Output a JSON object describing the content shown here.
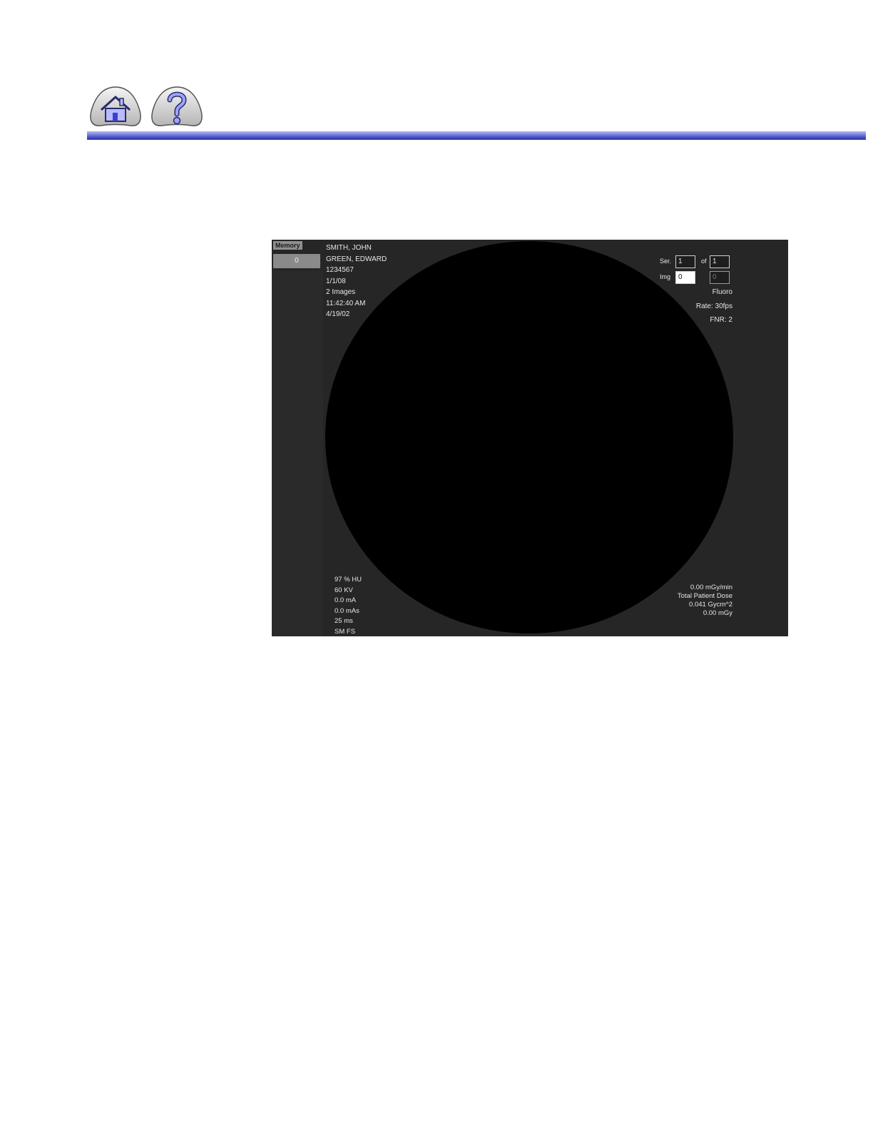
{
  "nav": {
    "home_icon": "home-icon",
    "help_icon": "question-mark-icon",
    "accent": "#4a52c8"
  },
  "memory": {
    "label": "Memory",
    "value": "0"
  },
  "patient": {
    "lines": [
      "SMITH, JOHN",
      "GREEN, EDWARD",
      "1234567",
      "1/1/08",
      "2 Images",
      "11:42:40 AM",
      "4/19/02"
    ]
  },
  "series": {
    "ser_label": "Ser.",
    "ser_value": "1",
    "of_label": "of",
    "of_value": "1"
  },
  "image": {
    "img_label": "Img",
    "img_value": "0",
    "total_value": "0"
  },
  "mode": {
    "name": "Fluoro",
    "rate": "Rate: 30fps",
    "fnr": "FNR: 2"
  },
  "technique": {
    "lines": [
      "97 % HU",
      "60 KV",
      "0.0 mA",
      "0.0 mAs",
      "25 ms",
      "SM FS"
    ]
  },
  "dose": {
    "lines": [
      "0.00 mGy/min",
      "Total Patient Dose",
      "0.041 Gycm^2",
      "0.00 mGy"
    ]
  }
}
